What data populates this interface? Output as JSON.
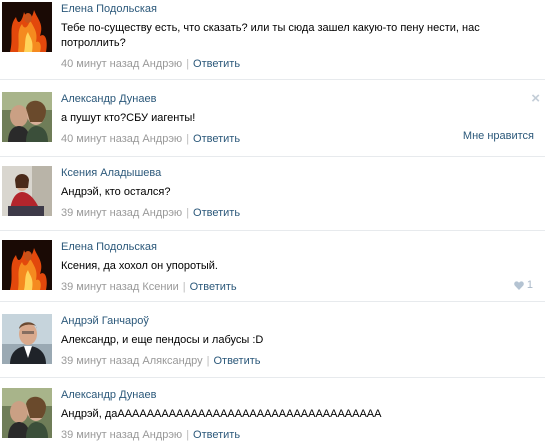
{
  "comments": [
    {
      "author": "Елена Подольская",
      "text": "Тебе по-существу есть, что сказать? или ты сюда зашел какую-то пену нести, нас потроллить?",
      "time": "40 минут назад Андрэю",
      "reply": "Ответить",
      "avatar": "fire-woman-avatar"
    },
    {
      "author": "Александр Дунаев",
      "text": "а пушут кто?СБУ иагенты!",
      "time": "40 минут назад Андрэю",
      "reply": "Ответить",
      "like_label": "Мне нравится",
      "close_icon": "×",
      "avatar": "couple-avatar"
    },
    {
      "author": "Ксения Аладышева",
      "text": "Андрэй, кто остался?",
      "time": "39 минут назад Андрэю",
      "reply": "Ответить",
      "avatar": "woman-sitting-avatar"
    },
    {
      "author": "Елена Подольская",
      "text": "Ксения, да хохол он упоротый.",
      "time": "39 минут назад Ксении",
      "reply": "Ответить",
      "likes": "1",
      "avatar": "fire-woman-avatar"
    },
    {
      "author": "Андрэй Ганчароў",
      "text": "Александр, и еще пендосы и лабусы :D",
      "time": "39 минут назад Аляксандру",
      "reply": "Ответить",
      "avatar": "man-portrait-avatar"
    },
    {
      "author": "Александр Дунаев",
      "text": "Андрэй, даАААААААААААААААААААААААААААААААААААА",
      "time": "39 минут назад Андрэю",
      "reply": "Ответить",
      "avatar": "couple-avatar"
    }
  ],
  "colors": {
    "link": "#2b587a",
    "meta": "#999999",
    "divider": "#e7eaed"
  }
}
